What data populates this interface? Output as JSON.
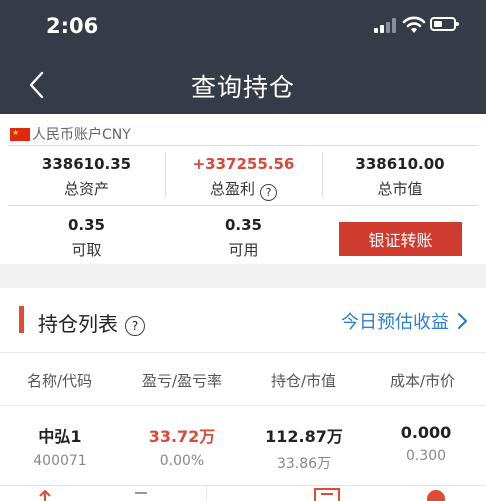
{
  "status": {
    "time": "2:06"
  },
  "nav": {
    "title": "查询持仓"
  },
  "account": {
    "label": "人民币账户CNY",
    "total_assets": {
      "value": "338610.35",
      "label": "总资产"
    },
    "total_profit": {
      "value": "+337255.56",
      "label": "总盈利"
    },
    "market_value": {
      "value": "338610.00",
      "label": "总市值"
    },
    "withdrawable": {
      "value": "0.35",
      "label": "可取"
    },
    "available": {
      "value": "0.35",
      "label": "可用"
    },
    "transfer_label": "银证转账"
  },
  "holdings": {
    "title": "持仓列表",
    "forecast_label": "今日预估收益",
    "columns": [
      "名称/代码",
      "盈亏/盈亏率",
      "持仓/市值",
      "成本/市价"
    ],
    "rows": [
      {
        "name": "中弘1",
        "code": "400071",
        "pnl": "33.72万",
        "pnl_rate": "0.00%",
        "position": "112.87万",
        "market_value": "33.86万",
        "cost": "0.000",
        "price": "0.300"
      }
    ]
  },
  "colors": {
    "header": "#363b48",
    "accent_red": "#d8493a",
    "link_blue": "#2f7fd1"
  }
}
